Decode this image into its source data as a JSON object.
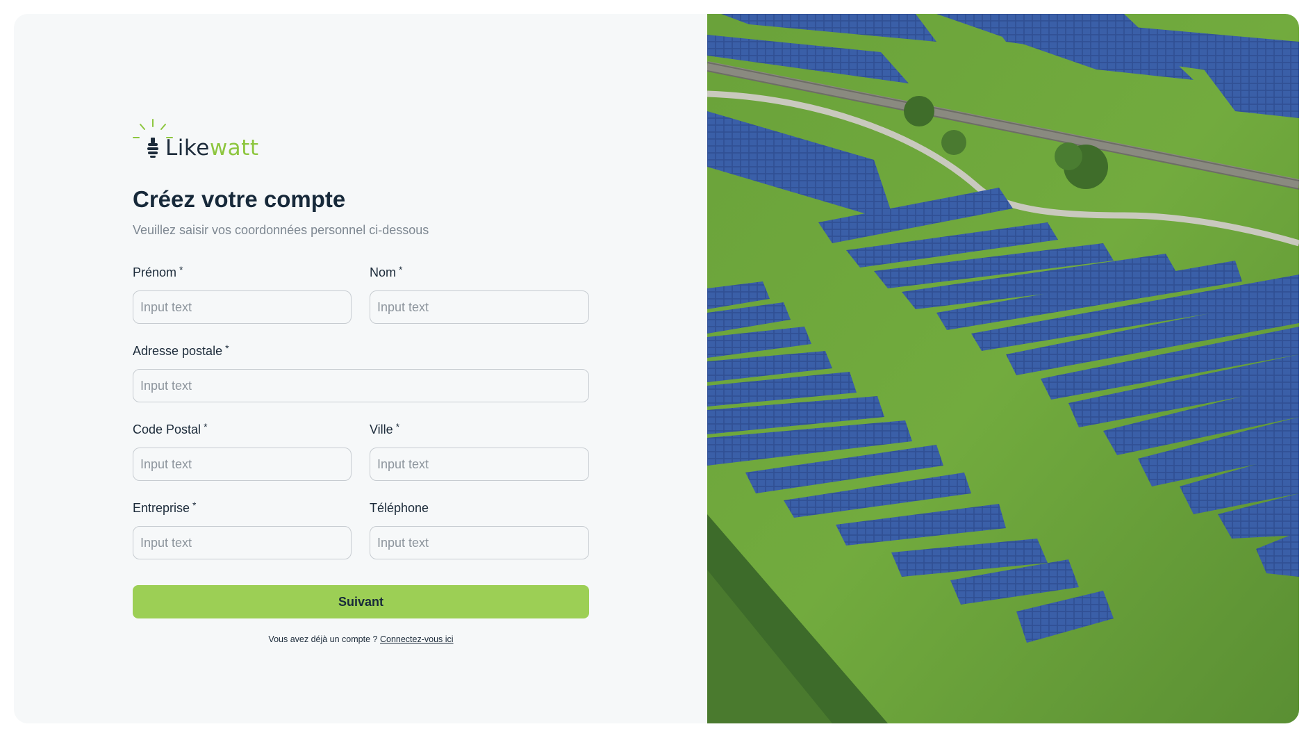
{
  "brand": {
    "name_part1": "Like",
    "name_part2": "watt"
  },
  "header": {
    "title": "Créez votre compte",
    "subtitle": "Veuillez saisir vos coordonnées personnel ci-dessous"
  },
  "form": {
    "required_mark": "*",
    "prenom": {
      "label": "Prénom",
      "placeholder": "Input text",
      "value": ""
    },
    "nom": {
      "label": "Nom",
      "placeholder": "Input text",
      "value": ""
    },
    "adresse": {
      "label": "Adresse postale",
      "placeholder": "Input text",
      "value": ""
    },
    "code_postal": {
      "label": "Code Postal",
      "placeholder": "Input text",
      "value": ""
    },
    "ville": {
      "label": "Ville",
      "placeholder": "Input text",
      "value": ""
    },
    "entreprise": {
      "label": "Entreprise",
      "placeholder": "Input text",
      "value": ""
    },
    "telephone": {
      "label": "Téléphone",
      "placeholder": "Input text",
      "value": ""
    },
    "submit_label": "Suivant"
  },
  "footer": {
    "login_prompt": "Vous avez déjà un compte ?",
    "login_link": "Connectez-vous ici"
  },
  "colors": {
    "accent_green": "#9ccf55",
    "brand_green": "#8dc63f",
    "text_dark": "#17293a",
    "background": "#f6f8f9"
  },
  "image": {
    "subject": "aerial-solar-farm-photo"
  }
}
